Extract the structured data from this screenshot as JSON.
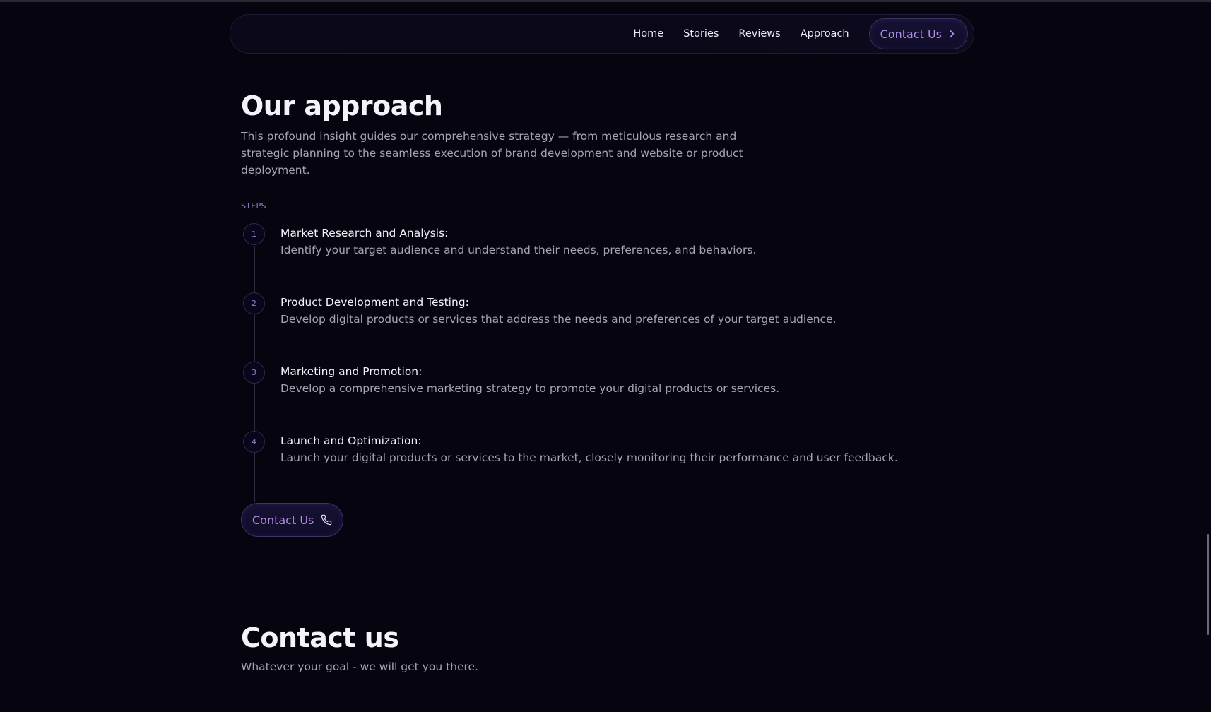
{
  "nav": {
    "links": [
      "Home",
      "Stories",
      "Reviews",
      "Approach"
    ],
    "cta_label": "Contact Us",
    "cta_icon": "chevron-right-icon"
  },
  "approach": {
    "title": "Our approach",
    "description": "This profound insight guides our comprehensive strategy — from meticulous research and strategic planning to the seamless execution of brand development and website or product deployment.",
    "steps_label": "STEPS",
    "steps": [
      {
        "number": "1",
        "title": "Market Research and Analysis:",
        "description": "Identify your target audience and understand their needs, preferences, and behaviors."
      },
      {
        "number": "2",
        "title": "Product Development and Testing:",
        "description": "Develop digital products or services that address the needs and preferences of your target audience."
      },
      {
        "number": "3",
        "title": "Marketing and Promotion:",
        "description": "Develop a comprehensive marketing strategy to promote your digital products or services."
      },
      {
        "number": "4",
        "title": "Launch and Optimization:",
        "description": "Launch your digital products or services to the market, closely monitoring their performance and user feedback."
      }
    ],
    "cta_label": "Contact Us",
    "cta_icon": "phone-icon"
  },
  "contact": {
    "title": "Contact us",
    "subtitle": "Whatever your goal - we will get you there."
  },
  "colors": {
    "background": "#06040f",
    "accent": "#b08ee6",
    "muted_text": "#a7a3b5",
    "step_number": "#8a80c8"
  }
}
